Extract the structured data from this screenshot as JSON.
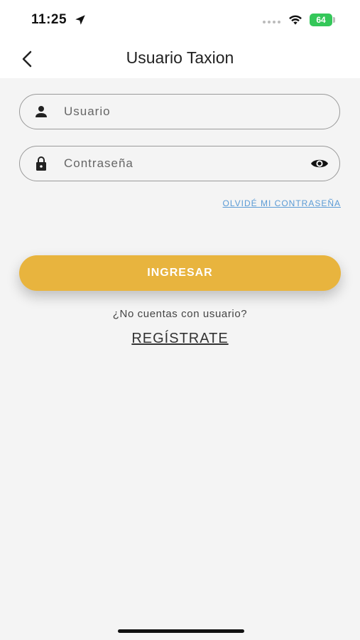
{
  "status_bar": {
    "time": "11:25",
    "battery": "64",
    "icons": [
      "location-arrow-icon",
      "wifi-icon",
      "battery-icon"
    ]
  },
  "header": {
    "title": "Usuario Taxion",
    "back_icon": "chevron-left-icon"
  },
  "form": {
    "username": {
      "placeholder": "Usuario",
      "value": "",
      "icon": "person-icon"
    },
    "password": {
      "placeholder": "Contraseña",
      "value": "",
      "icon": "lock-icon",
      "toggle_icon": "eye-icon"
    },
    "forgot_password": "OLVIDÉ MI CONTRASEÑA",
    "login_button": "INGRESAR"
  },
  "register": {
    "prompt": "¿No cuentas con usuario?",
    "link": "REGÍSTRATE"
  },
  "colors": {
    "accent": "#e8b43e",
    "link": "#5b9bd5",
    "background": "#f4f4f4",
    "battery": "#34c759"
  }
}
